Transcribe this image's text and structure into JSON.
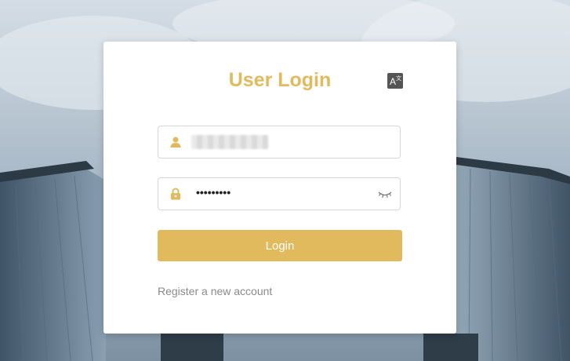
{
  "login_card": {
    "title": "User Login",
    "language_icon": "translate-icon",
    "username": {
      "icon": "user-icon",
      "value_obscured": true
    },
    "password": {
      "icon": "lock-icon",
      "masked_value": "•••••••••",
      "toggle_icon": "eye-closed-icon"
    },
    "login_button_label": "Login",
    "register_link_label": "Register a new account"
  },
  "colors": {
    "accent": "#e2ba5e",
    "card_bg": "#ffffff",
    "link": "#8a8a8a",
    "icon_bg": "#555555"
  }
}
